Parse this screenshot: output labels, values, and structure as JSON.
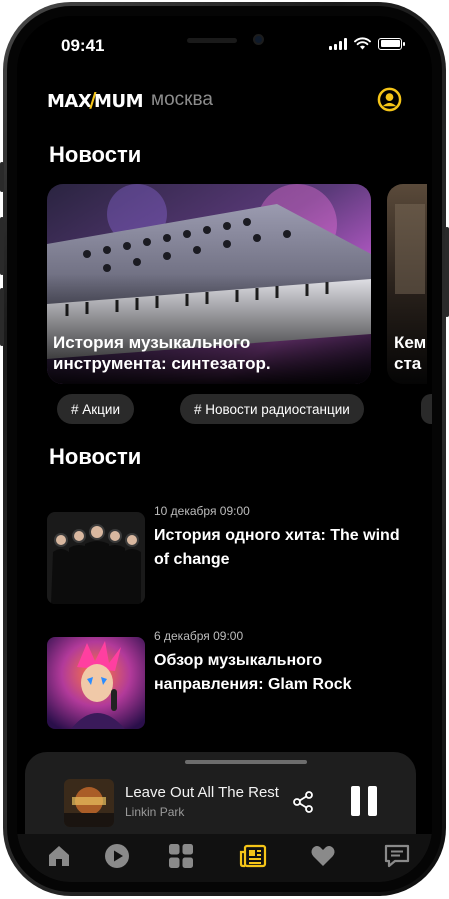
{
  "status_bar": {
    "time": "09:41"
  },
  "header": {
    "logo_left": "MAX",
    "logo_right": "MUM",
    "city": "москва"
  },
  "featured": {
    "section_title": "Новости",
    "cards": [
      {
        "title": "История музыкального инструмента: синтезатор."
      },
      {
        "title": "Кем\nста"
      }
    ],
    "tags": [
      "# Акции",
      "# Новости радиостанции"
    ]
  },
  "news": {
    "section_title": "Новости",
    "items": [
      {
        "date": "10 декабря 09:00",
        "title": "История одного хита: The wind of change"
      },
      {
        "date": "6 декабря 09:00",
        "title": "Обзор музыкального направления: Glam Rock"
      }
    ]
  },
  "player": {
    "track_title": "Leave Out All The Rest",
    "artist": "Linkin Park"
  },
  "nav": {
    "items": [
      "home-icon",
      "play-icon",
      "grid-icon",
      "news-icon",
      "heart-icon",
      "chat-icon"
    ],
    "active": "news-icon"
  },
  "colors": {
    "accent": "#f5c518",
    "background": "#000000",
    "chip": "#2a2a2a",
    "player": "#1e1e1e",
    "nav_inactive": "#8a8a8a"
  }
}
